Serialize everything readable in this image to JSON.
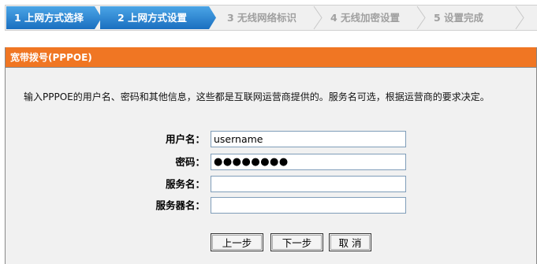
{
  "wizard": {
    "steps": [
      {
        "label": "1 上网方式选择",
        "state": "active"
      },
      {
        "label": "2 上网方式设置",
        "state": "active"
      },
      {
        "label": "3 无线网络标识",
        "state": "inactive"
      },
      {
        "label": "4 无线加密设置",
        "state": "inactive"
      },
      {
        "label": "5 设置完成",
        "state": "inactive"
      }
    ]
  },
  "panel": {
    "title": "宽带拨号(PPPOE)",
    "description": "输入PPPOE的用户名、密码和其他信息，这些都是互联网运营商提供的。服务名可选，根据运营商的要求决定。"
  },
  "form": {
    "username": {
      "label": "用户名：",
      "value": "username"
    },
    "password": {
      "label": "密码：",
      "value": "●●●●●●●●"
    },
    "service_name": {
      "label": "服务名：",
      "value": ""
    },
    "server_name": {
      "label": "服务器名：",
      "value": ""
    }
  },
  "buttons": {
    "prev": "上一步",
    "next": "下一步",
    "cancel": "取 消"
  },
  "colors": {
    "step_active": "#1a6fc0",
    "step_inactive_text": "#a0a0a0",
    "header_orange": "#f07623",
    "panel_bg": "#f1f1f1"
  }
}
